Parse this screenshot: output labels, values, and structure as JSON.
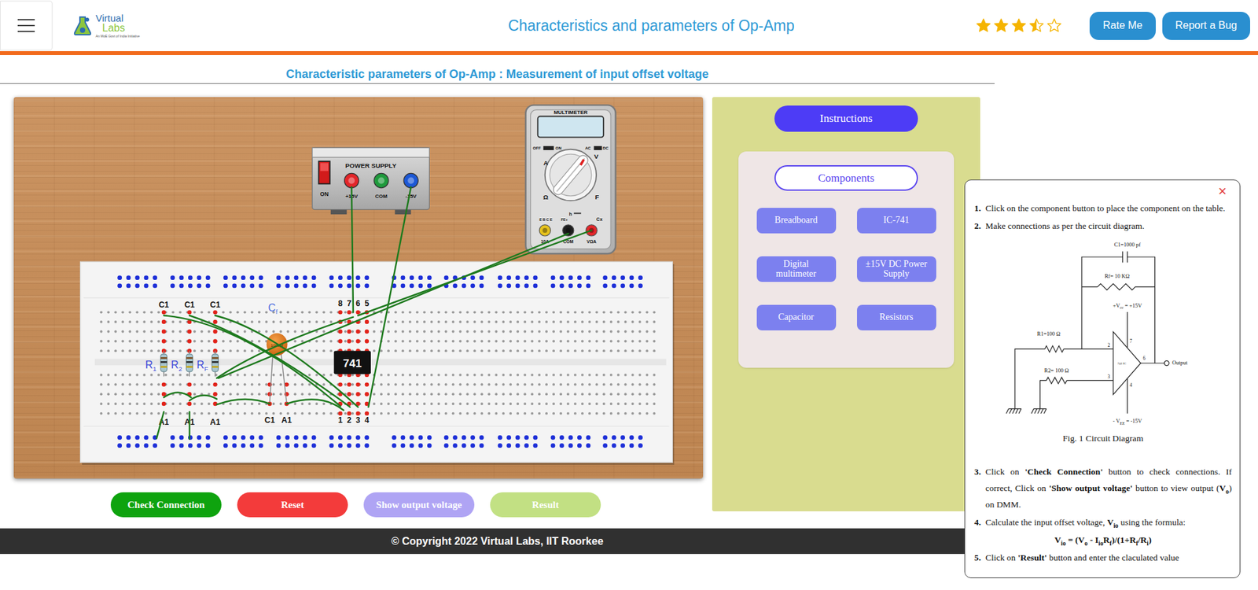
{
  "header": {
    "logo": {
      "name": "Virtual",
      "suffix": "Labs",
      "tagline": "An MoE Govt of India Initiative"
    },
    "title": "Characteristics and parameters of Op-Amp",
    "rating": {
      "stars": 3.5,
      "total": 5
    },
    "buttons": [
      "Rate Me",
      "Report a Bug"
    ]
  },
  "page_title": "Characteristic parameters of Op-Amp : Measurement of input offset voltage",
  "bench": {
    "power_supply": {
      "title": "POWER SUPPLY",
      "switch_label": "ON",
      "terminals": [
        {
          "label": "+15V",
          "color": "#e3262a"
        },
        {
          "label": "COM",
          "color": "#1f9a3c"
        },
        {
          "label": "-15V",
          "color": "#1c58d6"
        }
      ]
    },
    "multimeter": {
      "title": "MULTIMETER",
      "power_labels": [
        "OFF",
        "ON"
      ],
      "mode_labels": [
        "AC",
        "DC"
      ],
      "dial_labels": [
        "A",
        "V",
        "Ω",
        "F"
      ],
      "hfe_label": "h",
      "socket_labels": [
        "E B C E",
        "FE+",
        "Cx"
      ],
      "terminals": [
        {
          "label": "10A",
          "color": "#e6c21c"
        },
        {
          "label": "COM",
          "color": "#1e1e1e"
        },
        {
          "label": "VΩA",
          "color": "#e3262a"
        }
      ]
    },
    "breadboard": {
      "resistor_top_labels": [
        "C1",
        "C1",
        "C1"
      ],
      "resistors": [
        {
          "name": "R",
          "sub": "1"
        },
        {
          "name": "R",
          "sub": "2"
        },
        {
          "name": "R",
          "sub": "F"
        }
      ],
      "resistor_bottom_labels": [
        "A1",
        "A1",
        "A1"
      ],
      "capacitor": {
        "name": "C",
        "sub": "f",
        "value": "1000pf",
        "leg_labels": [
          "C1",
          "A1"
        ]
      },
      "ic": {
        "label": "741",
        "top_pins": [
          "8",
          "7",
          "6",
          "5"
        ],
        "bottom_pins": [
          "1",
          "2",
          "3",
          "4"
        ]
      }
    }
  },
  "controls": [
    {
      "label": "Check Connection",
      "color": "#0ea30e",
      "disabled": false
    },
    {
      "label": "Reset",
      "color": "#f33b3b",
      "disabled": false
    },
    {
      "label": "Show output voltage",
      "color": "#7b68ee",
      "disabled": true
    },
    {
      "label": "Result",
      "color": "#9acd32",
      "disabled": true
    }
  ],
  "side_panel": {
    "instructions_button": "Instructions",
    "components_title": "Components",
    "components": [
      "Breadboard",
      "IC-741",
      "Digital multimeter",
      "±15V DC Power Supply",
      "Capacitor",
      "Resistors"
    ]
  },
  "footer": "© Copyright 2022 Virtual Labs, IIT Roorkee",
  "instructions_popup": {
    "close": "×",
    "items": [
      {
        "kind": "step",
        "number": "1.",
        "parts": [
          {
            "text": "Click on the component button to place the component on the table.",
            "style": "normal"
          }
        ]
      },
      {
        "kind": "step",
        "number": "2.",
        "parts": [
          {
            "text": "Make connections as per the circuit diagram.",
            "style": "normal"
          }
        ]
      },
      {
        "kind": "figure",
        "caption": "Fig. 1 Circuit Diagram",
        "labels": {
          "cap": "C1=1000 pf",
          "rf": "Rf= 10 KΩ",
          "vcc": {
            "main": "+V",
            "sub": "cc",
            "rest": " = +15V"
          },
          "r1": "R1=100 Ω",
          "r2": "R2= 100 Ω",
          "ic": "741 IC",
          "pins": {
            "inv": "2",
            "noninv": "3",
            "vpos": "7",
            "vneg": "4",
            "out": "6"
          },
          "output": "Output",
          "vee": {
            "main": "- V",
            "sub": "EE",
            "rest": " = -15V"
          }
        }
      },
      {
        "kind": "step",
        "number": "3.",
        "parts": [
          {
            "text": "Click on ",
            "style": "normal"
          },
          {
            "text": "'Check Connection'",
            "style": "bold"
          },
          {
            "text": " button to check connections. If correct, Click on ",
            "style": "normal"
          },
          {
            "text": "'Show output voltage'",
            "style": "bold"
          },
          {
            "text": " button to view output (",
            "style": "normal"
          },
          {
            "text": "V",
            "style": "bold"
          },
          {
            "text": "o",
            "style": "sub"
          },
          {
            "text": ") on DMM.",
            "style": "normal"
          }
        ]
      },
      {
        "kind": "step",
        "number": "4.",
        "parts": [
          {
            "text": "Calculate the input offset voltage, ",
            "style": "normal"
          },
          {
            "text": "V",
            "style": "bold"
          },
          {
            "text": "io",
            "style": "sub"
          },
          {
            "text": " using the formula:",
            "style": "normal"
          }
        ]
      },
      {
        "kind": "formula",
        "parts": [
          {
            "text": "V",
            "style": "bold"
          },
          {
            "text": "io",
            "style": "sub"
          },
          {
            "text": " = (V",
            "style": "bold"
          },
          {
            "text": "o",
            "style": "sub"
          },
          {
            "text": " - I",
            "style": "bold"
          },
          {
            "text": "io",
            "style": "sub"
          },
          {
            "text": "R",
            "style": "bold"
          },
          {
            "text": "f",
            "style": "sub"
          },
          {
            "text": ")/(1+R",
            "style": "bold"
          },
          {
            "text": "f",
            "style": "sub"
          },
          {
            "text": "/R",
            "style": "bold"
          },
          {
            "text": "i",
            "style": "sub"
          },
          {
            "text": ")",
            "style": "bold"
          }
        ]
      },
      {
        "kind": "step",
        "number": "5.",
        "parts": [
          {
            "text": "Click on ",
            "style": "normal"
          },
          {
            "text": "'Result'",
            "style": "bold"
          },
          {
            "text": " button and enter the claculated value",
            "style": "normal"
          }
        ]
      }
    ]
  }
}
